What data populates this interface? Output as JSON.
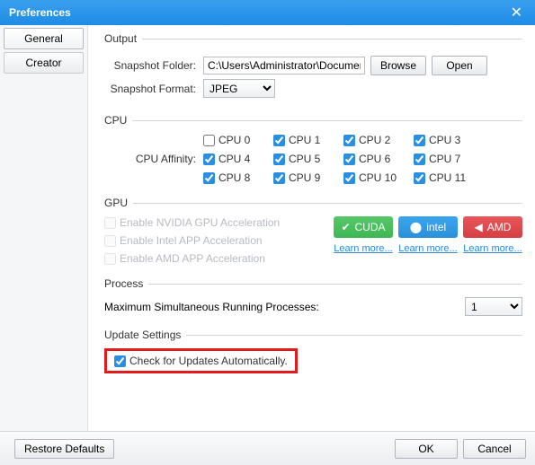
{
  "title": "Preferences",
  "sidebar": {
    "tabs": [
      {
        "label": "General"
      },
      {
        "label": "Creator"
      }
    ]
  },
  "output": {
    "legend": "Output",
    "folder_label": "Snapshot Folder:",
    "folder_value": "C:\\Users\\Administrator\\Documents\\A",
    "browse": "Browse",
    "open": "Open",
    "format_label": "Snapshot Format:",
    "format_value": "JPEG"
  },
  "cpu": {
    "legend": "CPU",
    "affinity_label": "CPU Affinity:",
    "items": [
      "CPU 0",
      "CPU 1",
      "CPU 2",
      "CPU 3",
      "CPU 4",
      "CPU 5",
      "CPU 6",
      "CPU 7",
      "CPU 8",
      "CPU 9",
      "CPU 10",
      "CPU 11"
    ]
  },
  "gpu": {
    "legend": "GPU",
    "nvidia": "Enable NVIDIA GPU Acceleration",
    "intel": "Enable Intel APP Acceleration",
    "amd": "Enable AMD APP Acceleration",
    "cuda_btn": "CUDA",
    "intel_btn": "intel",
    "amd_btn": "AMD",
    "learn": "Learn more..."
  },
  "process": {
    "legend": "Process",
    "label": "Maximum Simultaneous Running Processes:",
    "value": "1"
  },
  "update": {
    "legend": "Update Settings",
    "check": "Check for Updates Automatically."
  },
  "footer": {
    "restore": "Restore Defaults",
    "ok": "OK",
    "cancel": "Cancel"
  }
}
